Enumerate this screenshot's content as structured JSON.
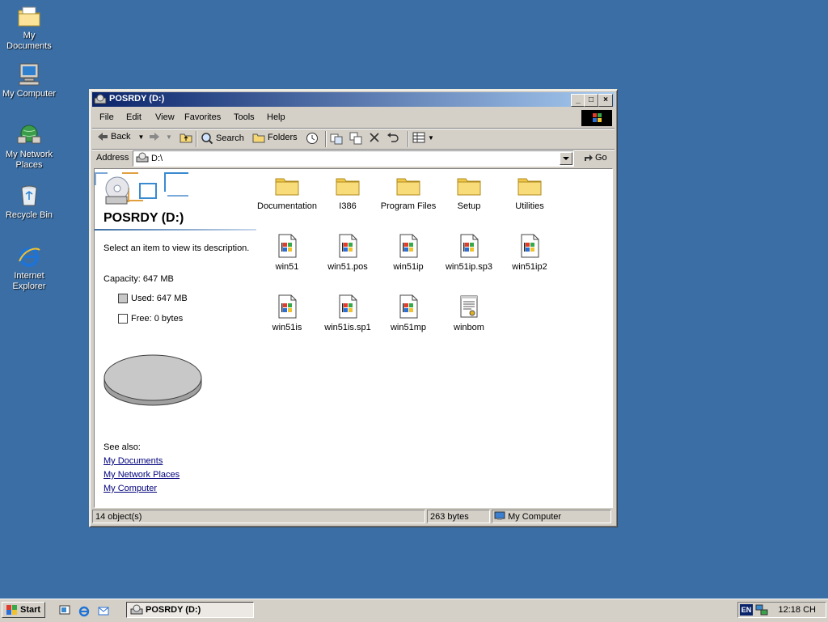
{
  "desktop": {
    "icons": [
      {
        "label": "My Documents"
      },
      {
        "label": "My Computer"
      },
      {
        "label": "My Network Places"
      },
      {
        "label": "Recycle Bin"
      },
      {
        "label": "Internet Explorer"
      }
    ]
  },
  "window": {
    "title": "POSRDY (D:)",
    "menu": [
      "File",
      "Edit",
      "View",
      "Favorites",
      "Tools",
      "Help"
    ],
    "toolbar": {
      "back": "Back",
      "search": "Search",
      "folders": "Folders"
    },
    "address": {
      "label": "Address",
      "value": "D:\\",
      "go": "Go"
    },
    "left_pane": {
      "title": "POSRDY (D:)",
      "description": "Select an item to view its description.",
      "capacity": "Capacity: 647 MB",
      "used": "Used: 647 MB",
      "free": "Free: 0 bytes",
      "see_also": "See also:",
      "links": [
        "My Documents",
        "My Network Places",
        "My Computer"
      ]
    },
    "files": [
      {
        "name": "Documentation",
        "type": "folder"
      },
      {
        "name": "I386",
        "type": "folder"
      },
      {
        "name": "Program Files",
        "type": "folder"
      },
      {
        "name": "Setup",
        "type": "folder"
      },
      {
        "name": "Utilities",
        "type": "folder"
      },
      {
        "name": "win51",
        "type": "sysfile"
      },
      {
        "name": "win51.pos",
        "type": "sysfile"
      },
      {
        "name": "win51ip",
        "type": "sysfile"
      },
      {
        "name": "win51ip.sp3",
        "type": "sysfile"
      },
      {
        "name": "win51ip2",
        "type": "sysfile"
      },
      {
        "name": "win51is",
        "type": "sysfile"
      },
      {
        "name": "win51is.sp1",
        "type": "sysfile"
      },
      {
        "name": "win51mp",
        "type": "sysfile"
      },
      {
        "name": "winbom",
        "type": "textfile"
      }
    ],
    "status": {
      "objects": "14 object(s)",
      "size": "263 bytes",
      "zone": "My Computer"
    }
  },
  "taskbar": {
    "start": "Start",
    "task": "POSRDY (D:)",
    "lang": "EN",
    "clock": "12:18 CH"
  },
  "colors": {
    "desktop": "#3a6ea5",
    "titlebar": "#0a246a",
    "link": "#00007c"
  }
}
